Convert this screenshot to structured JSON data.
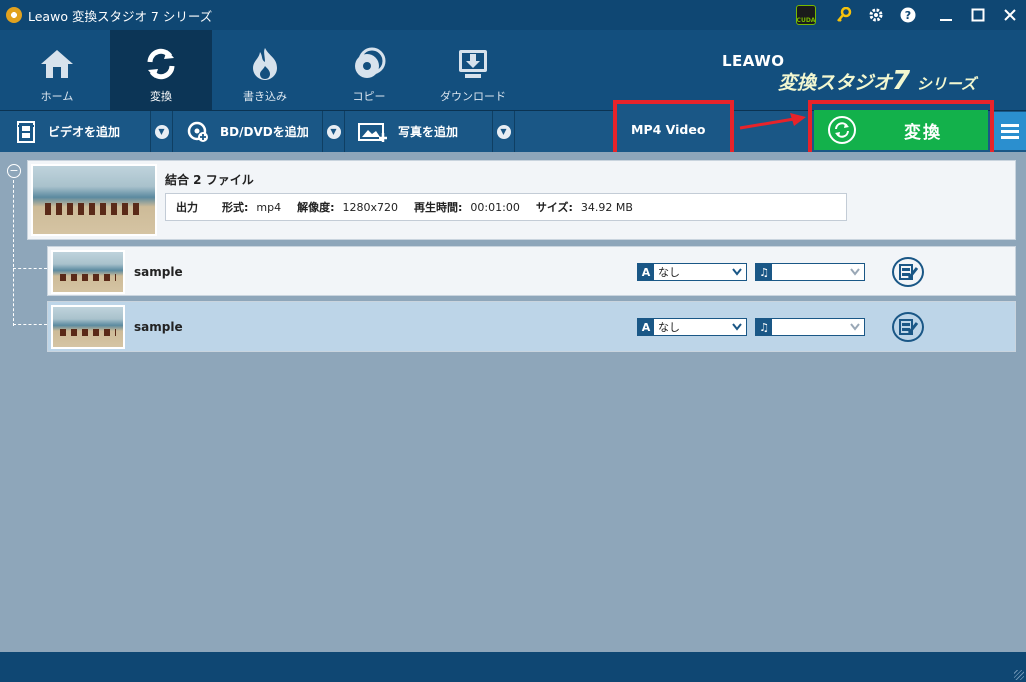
{
  "window": {
    "title": "Leawo 変換スタジオ 7 シリーズ",
    "cuda_label": "CUDA"
  },
  "nav": {
    "items": [
      {
        "label": "ホーム"
      },
      {
        "label": "変換"
      },
      {
        "label": "書き込み"
      },
      {
        "label": "コピー"
      },
      {
        "label": "ダウンロード"
      }
    ],
    "active": 1
  },
  "brand": {
    "leawo": "LEAWO",
    "title_prefix": "変換スタジオ",
    "title_num": "7",
    "title_suffix": "シリーズ"
  },
  "toolbar": {
    "add_video": "ビデオを追加",
    "add_disc": "BD/DVDを追加",
    "add_photo": "写真を追加",
    "format": "MP4 Video",
    "convert": "変換"
  },
  "merged": {
    "title": "結合 2 ファイル",
    "output_label": "出力",
    "format_label": "形式:",
    "format_value": "mp4",
    "resolution_label": "解像度:",
    "resolution_value": "1280x720",
    "duration_label": "再生時間:",
    "duration_value": "00:01:00",
    "size_label": "サイズ:",
    "size_value": "34.92 MB"
  },
  "files": [
    {
      "name": "sample",
      "subtitle": "なし",
      "subtitle_badge": "A",
      "audio": "",
      "selected": false
    },
    {
      "name": "sample",
      "subtitle": "なし",
      "subtitle_badge": "A",
      "audio": "",
      "selected": true
    }
  ],
  "colors": {
    "accent_green": "#13b14b",
    "highlight_red": "#e8232a",
    "nav_blue": "#134f7e"
  }
}
